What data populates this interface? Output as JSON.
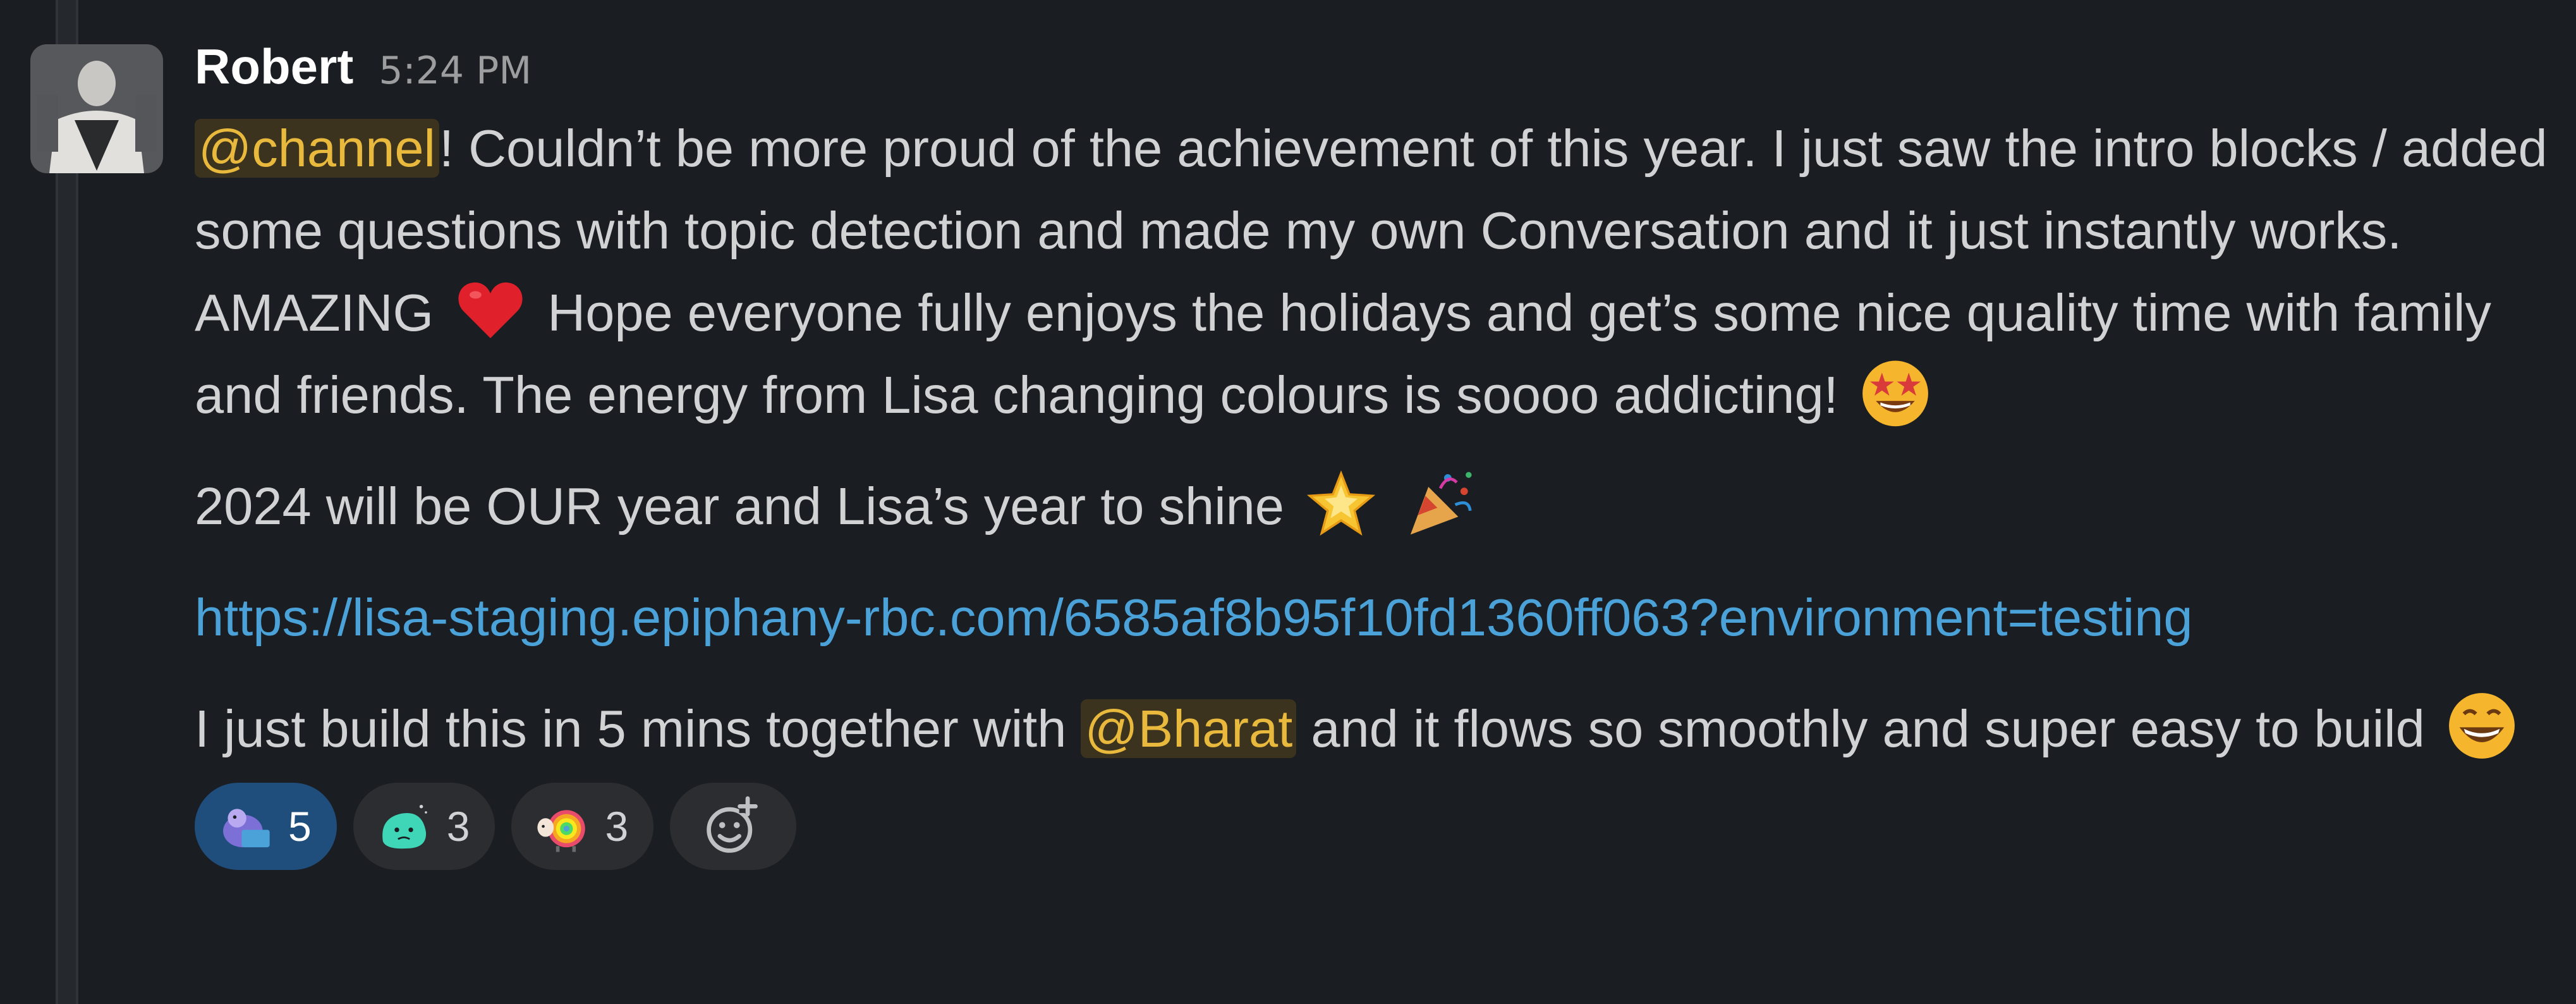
{
  "message": {
    "author": "Robert",
    "timestamp": "5:24 PM",
    "p1": {
      "mention": "@channel",
      "text_a": "! Couldn’t be more proud of the achievement of this year. I just saw the intro blocks / added some questions with topic detection and made my own Conversation and it just instantly works. AMAZING",
      "text_b": " Hope everyone fully enjoys the holidays and get’s some nice quality time with family and friends.  The energy from Lisa changing colours is soooo addicting!"
    },
    "p2": {
      "text": "2024 will be OUR year and Lisa’s year to shine"
    },
    "p3": {
      "link": "https://lisa-staging.epiphany-rbc.com/6585af8b95f10fd1360ff063?environment=testing"
    },
    "p4": {
      "text_a": "I just build this in 5 mins together with ",
      "mention": "@Bharat",
      "text_b": " and it flows so smoothly and super easy to build"
    }
  },
  "emojis": {
    "p1_first": "red-heart-icon",
    "p1_second": "star-struck-icon",
    "p2_first": "glowing-star-icon",
    "p2_second": "party-popper-icon",
    "p4_first": "grinning-face-icon"
  },
  "reactions": [
    {
      "icon": "custom-animal-reaction-icon",
      "count": "5",
      "active": true
    },
    {
      "icon": "teal-blob-reaction-icon",
      "count": "3",
      "active": false
    },
    {
      "icon": "rainbow-sheep-reaction-icon",
      "count": "3",
      "active": false
    }
  ],
  "colors": {
    "background": "#1a1d21",
    "text": "#d1d2d3",
    "mention_bg": "#3b331d",
    "mention_text": "#e8b93d",
    "link": "#4aa2d9",
    "active_reaction": "#1f4e7d"
  }
}
